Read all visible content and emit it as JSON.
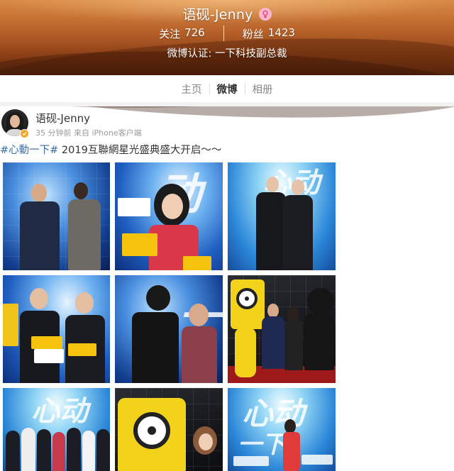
{
  "profile": {
    "name": "语砚-Jenny",
    "follow_label": "关注",
    "follow_count": "726",
    "fans_label": "粉丝",
    "fans_count": "1423",
    "verification": "微博认证: 一下科技副总裁"
  },
  "tabs": [
    {
      "label": "主页",
      "active": false
    },
    {
      "label": "微博",
      "active": true
    },
    {
      "label": "相册",
      "active": false
    }
  ],
  "post": {
    "author": "语砚-Jenny",
    "meta": "35 分钟前  来自 iPhone客户端",
    "hashtag": "#心動一下#",
    "text": "2019互聯網星光盛典盛大开启～～",
    "photo_count": 9
  },
  "colors": {
    "hashtag": "#3b6ea5",
    "header_orange": "#b9632a",
    "badge_gold": "#f5a623",
    "gender_pink": "#ffb6d0"
  },
  "icons": {
    "gender": "female-icon",
    "verified": "verified-badge-icon"
  }
}
